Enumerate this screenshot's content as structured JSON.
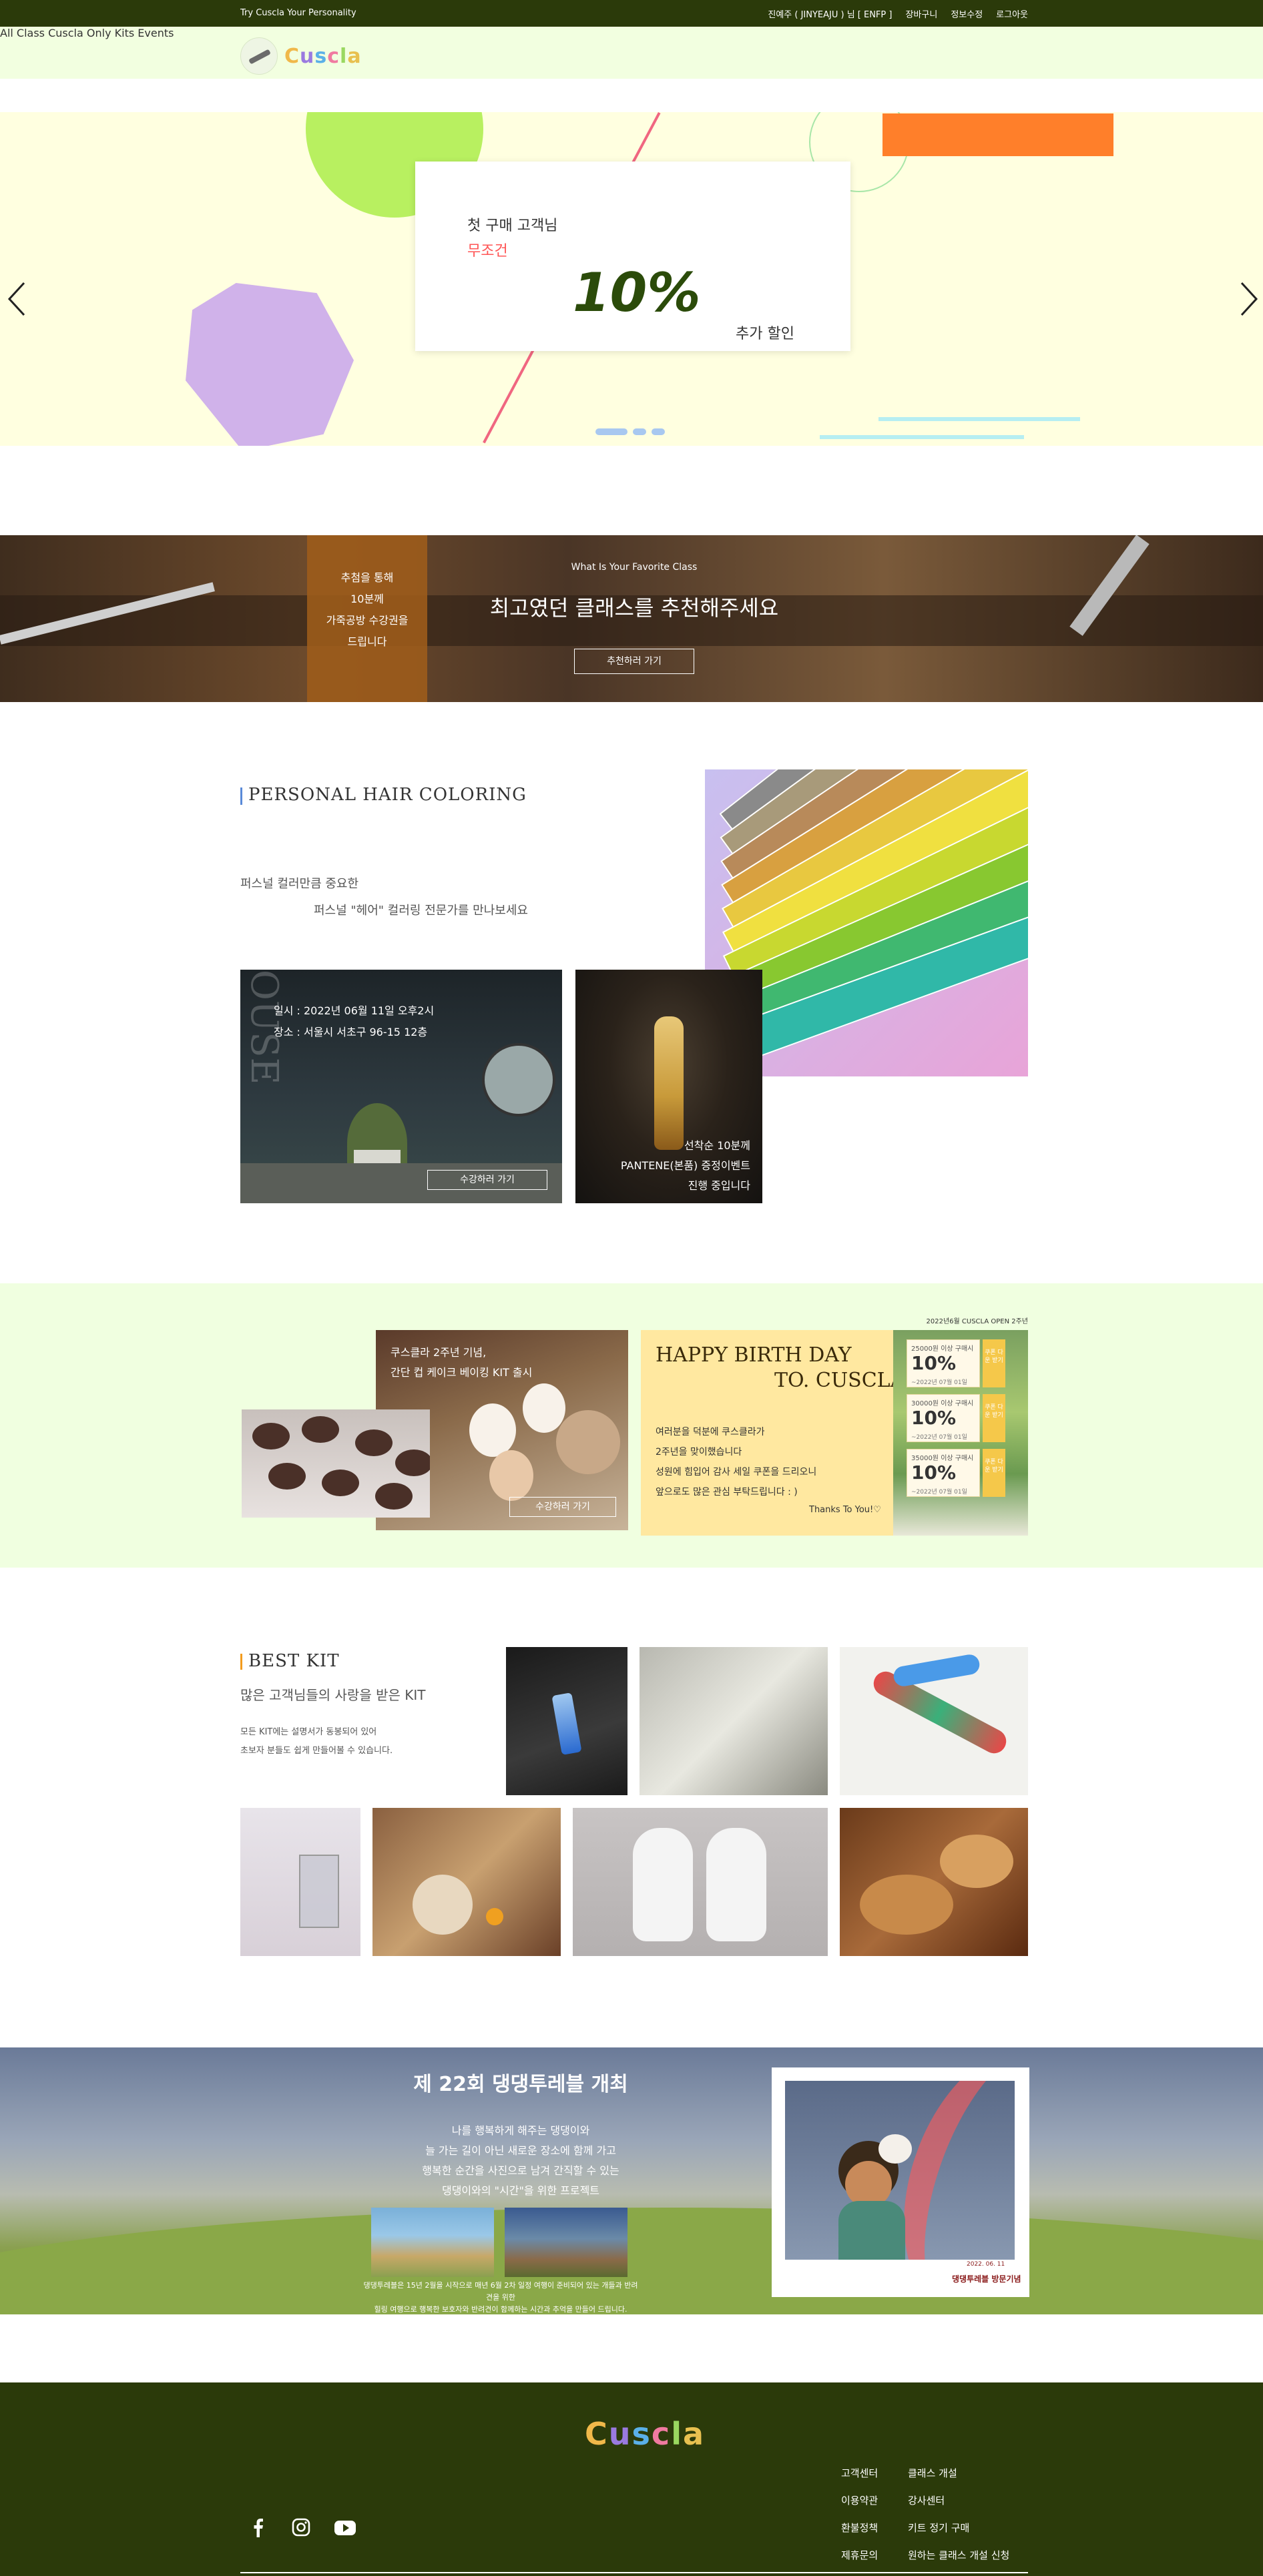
{
  "topbar": {
    "brand": "Try Cuscla Your Personality",
    "links": [
      "진예주 ( JINYEAJU ) 님 [ ENFP ]",
      "장바구니",
      "정보수정",
      "로그아웃"
    ]
  },
  "nav": {
    "logo_text": "Cuscla",
    "logo_letter_colors": [
      "#f0b84a",
      "#9a7ae0",
      "#5ab0e8",
      "#f07aa0",
      "#9ad860",
      "#e8c050"
    ],
    "menu": [
      "All Class",
      "Cuscla",
      "Only Kits",
      "Events"
    ]
  },
  "hero": {
    "line1": "첫 구매 고객님",
    "line2": "무조건",
    "discount": "10%",
    "line3": "추가 할인",
    "prev_icon": "chevron-left-icon",
    "next_icon": "chevron-right-icon",
    "slide_count": 3,
    "active_slide": 1
  },
  "favorite": {
    "box_lines": [
      "추첨을 통해",
      "10분께",
      "가죽공방 수강권을",
      "드립니다"
    ],
    "subtitle": "What Is Your Favorite Class",
    "headline": "최고였던 클래스를 추천해주세요",
    "button": "추천하러 가기"
  },
  "hair": {
    "title": "PERSONAL HAIR COLORING",
    "desc1": "퍼스널 컬러만큼 중요한",
    "desc2": "퍼스널 \"헤어\" 컬러링 전문가를 만나보세요",
    "photo1_letters": "OUSE",
    "photo1_line1": "일시 : 2022년 06월 11일 오후2시",
    "photo1_line2": "장소 : 서울시 서초구 96-15 12층",
    "photo1_button": "수강하러 가기",
    "photo2_lines": [
      "선착순 10분께",
      "PANTENE(본품) 증정이벤트",
      "진행 중입니다"
    ]
  },
  "event": {
    "tiny_label": "2022년6월 CUSCLA OPEN 2주년",
    "bake_line1": "쿠스클라 2주년 기념,",
    "bake_line2": "간단 컵 케이크 베이킹 KIT 출시",
    "bake_button": "수강하러 가기",
    "bday_title1": "HAPPY BIRTH DAY",
    "bday_title2": "TO. CUSCLA",
    "bday_lines": [
      "여러분을 덕분에 쿠스클라가",
      "2주년을 맞이했습니다",
      "성원에 힘입어 감사 세일 쿠폰을 드리오니",
      "앞으로도 많은 관심 부탁드립니다 : )"
    ],
    "bday_thanks": "Thanks To You!♡",
    "coupons": [
      {
        "condition": "25000원 이상 구매시",
        "value": "10%",
        "period": "~2022년 07월 01일",
        "side": "쿠폰 다운 받기"
      },
      {
        "condition": "30000원 이상 구매시",
        "value": "10%",
        "period": "~2022년 07월 01일",
        "side": "쿠폰 다운 받기"
      },
      {
        "condition": "35000원 이상 구매시",
        "value": "10%",
        "period": "~2022년 07월 01일",
        "side": "쿠폰 다운 받기"
      }
    ]
  },
  "kit": {
    "title": "BEST KIT",
    "subtitle": "많은 고객님들의 사랑을 받은 KIT",
    "desc1": "모든 KIT에는 설명서가 동봉되어 있어",
    "desc2": "초보자 분들도 쉽게 만들어볼 수 있습니다."
  },
  "pet": {
    "title": "제 22회 댕댕투레블 개최",
    "lines": [
      "나를 행복하게 해주는 댕댕이와",
      "늘 가는 길이 아닌 새로운 장소에 함께 가고",
      "행복한 순간을 사진으로 남겨 간직할 수 있는",
      "댕댕이와의 \"시간\"을 위한 프로젝트"
    ],
    "note1": "댕댕투레블은 15년 2월을 시작으로 매년 6월 2차 일정 여행이 준비되어 있는 개들과 반려견을 위한",
    "note2": "힐링 여행으로 행복한 보호자와 반려견이 함께하는 시간과 추억을 만들어 드립니다.",
    "photo_date": "2022. 06. 11",
    "photo_sign": "댕댕투레블 방문기념"
  },
  "footer": {
    "logo_text": "Cuscla",
    "col1": [
      "고객센터",
      "이용약관",
      "환불정책",
      "제휴문의"
    ],
    "col2": [
      "클래스 개설",
      "강사센터",
      "키트 정기 구매",
      "원하는 클래스 개설 신청"
    ],
    "social": [
      "facebook-icon",
      "instagram-icon",
      "youtube-icon"
    ]
  }
}
